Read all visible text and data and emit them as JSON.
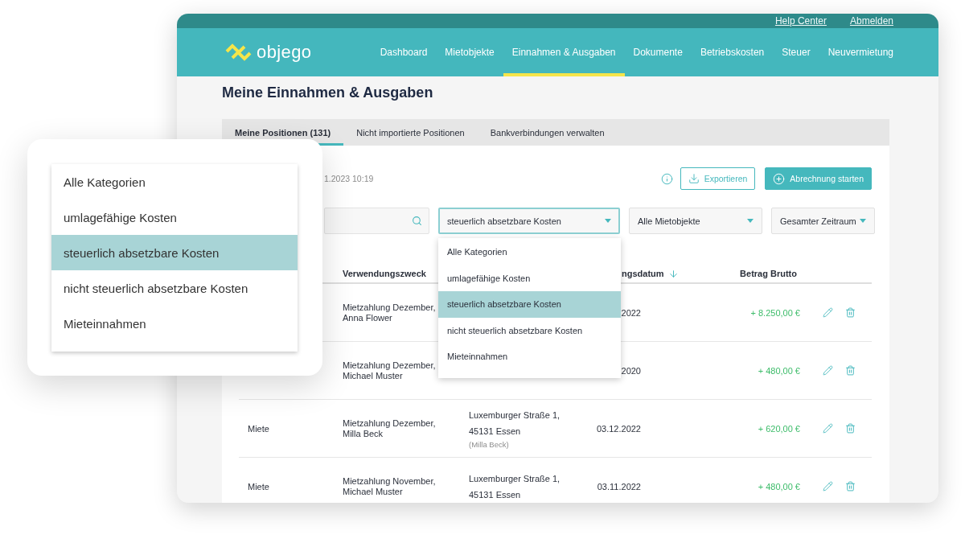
{
  "top_links": [
    {
      "label": "Help Center"
    },
    {
      "label": "Abmelden"
    }
  ],
  "logo": {
    "text": "objego"
  },
  "nav": [
    {
      "label": "Dashboard",
      "selected": false
    },
    {
      "label": "Mietobjekte",
      "selected": false
    },
    {
      "label": "Einnahmen & Ausgaben",
      "selected": true
    },
    {
      "label": "Dokumente",
      "selected": false
    },
    {
      "label": "Betriebskosten",
      "selected": false
    },
    {
      "label": "Steuer",
      "selected": false
    },
    {
      "label": "Neuvermietung",
      "selected": false
    }
  ],
  "page_title": "Meine Einnahmen & Ausgaben",
  "tabs": [
    {
      "label": "Meine Positionen (131)",
      "selected": true
    },
    {
      "label": "Nicht importierte Positionen",
      "selected": false
    },
    {
      "label": "Bankverbindungen verwalten",
      "selected": false
    }
  ],
  "zoom_card": {
    "options": [
      {
        "label": "Alle Kategorien",
        "selected": false
      },
      {
        "label": "umlagefähige Kosten",
        "selected": false
      },
      {
        "label": "steuerlich absetzbare Kosten",
        "selected": true
      },
      {
        "label": "nicht steuerlich absetzbare Kosten",
        "selected": false
      },
      {
        "label": "Mieteinnahmen",
        "selected": false
      }
    ]
  },
  "last_update": "1.2023 10:19",
  "actions": [
    {
      "kind": "outline",
      "label": "Exportieren"
    },
    {
      "kind": "primary",
      "label": "Abrechnung starten"
    }
  ],
  "filters": [
    {
      "kind": "search"
    },
    {
      "kind": "select",
      "value": "steuerlich absetzbare Kosten",
      "expanded": true,
      "options": [
        {
          "label": "Alle Kategorien",
          "selected": false
        },
        {
          "label": "umlagefähige Kosten",
          "selected": false
        },
        {
          "label": "steuerlich absetzbare Kosten",
          "selected": true
        },
        {
          "label": "nicht steuerlich absetzbare Kosten",
          "selected": false
        },
        {
          "label": "Mieteinnahmen",
          "selected": false
        }
      ]
    },
    {
      "kind": "select",
      "value": "Alle Mietobjekte",
      "expanded": false
    },
    {
      "kind": "select",
      "value": "Gesamter Zeitraum",
      "expanded": false
    }
  ],
  "table": {
    "columns": {
      "purpose": {
        "label": "Verwendungszweck"
      },
      "date": {
        "label": "ngsdatum",
        "sorted": true
      },
      "amount": {
        "label": "Betrag Brutto"
      }
    },
    "rows": [
      {
        "purpose": "Mietzahlung Dezember, Anna Flower",
        "date": "2022",
        "amount": "+ 8.250,00 €"
      },
      {
        "purpose": "Mietzahlung Dezember, Michael Muster",
        "date": "2020",
        "amount": "+ 480,00 €"
      },
      {
        "type": "Miete",
        "purpose": "Mietzahlung Dezember, Milla Beck",
        "address": "Luxemburger Straße 1, 45131 Essen",
        "tenant": "(Milla Beck)",
        "date": "03.12.2022",
        "amount": "+ 620,00 €"
      },
      {
        "type": "Miete",
        "purpose": "Mietzahlung November, Michael Muster",
        "address": "Luxemburger Straße 1, 45131 Essen",
        "date": "03.11.2022",
        "amount": "+ 480,00 €"
      }
    ]
  }
}
